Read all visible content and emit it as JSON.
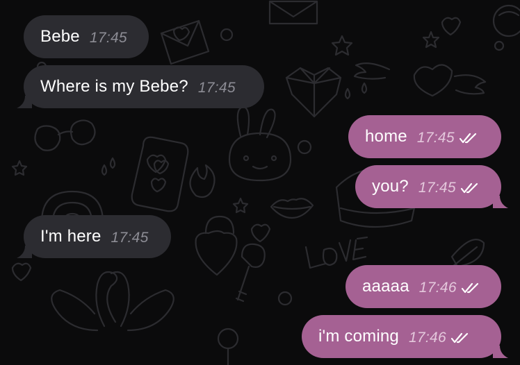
{
  "messages": [
    {
      "text": "Bebe",
      "time": "17:45",
      "direction": "incoming"
    },
    {
      "text": "Where is my Bebe?",
      "time": "17:45",
      "direction": "incoming"
    },
    {
      "text": "home",
      "time": "17:45",
      "direction": "outgoing",
      "status_icon": "double-check-icon"
    },
    {
      "text": "you?",
      "time": "17:45",
      "direction": "outgoing",
      "status_icon": "double-check-icon"
    },
    {
      "text": "I'm here",
      "time": "17:45",
      "direction": "incoming"
    },
    {
      "text": "aaaaa",
      "time": "17:46",
      "direction": "outgoing",
      "status_icon": "double-check-icon"
    },
    {
      "text": "i'm coming",
      "time": "17:46",
      "direction": "outgoing",
      "status_icon": "double-check-icon"
    }
  ],
  "colors": {
    "background": "#0b0b0c",
    "incoming_bubble": "#2c2c31",
    "outgoing_bubble": "#a56193",
    "wallpaper_doodle": "#2c2c30"
  },
  "wallpaper": {
    "style": "love doodles",
    "icons": [
      "heart-icon",
      "envelope-icon",
      "star-icon",
      "winged-heart-icon",
      "crystal-heart-icon",
      "bunny-icon",
      "phone-icon",
      "sunglasses-icon",
      "swans-icon",
      "lips-icon",
      "padlock-icon",
      "key-icon",
      "rainbow-icon",
      "flame-icon",
      "cake-icon",
      "lollipop-icon",
      "feather-icon"
    ]
  }
}
